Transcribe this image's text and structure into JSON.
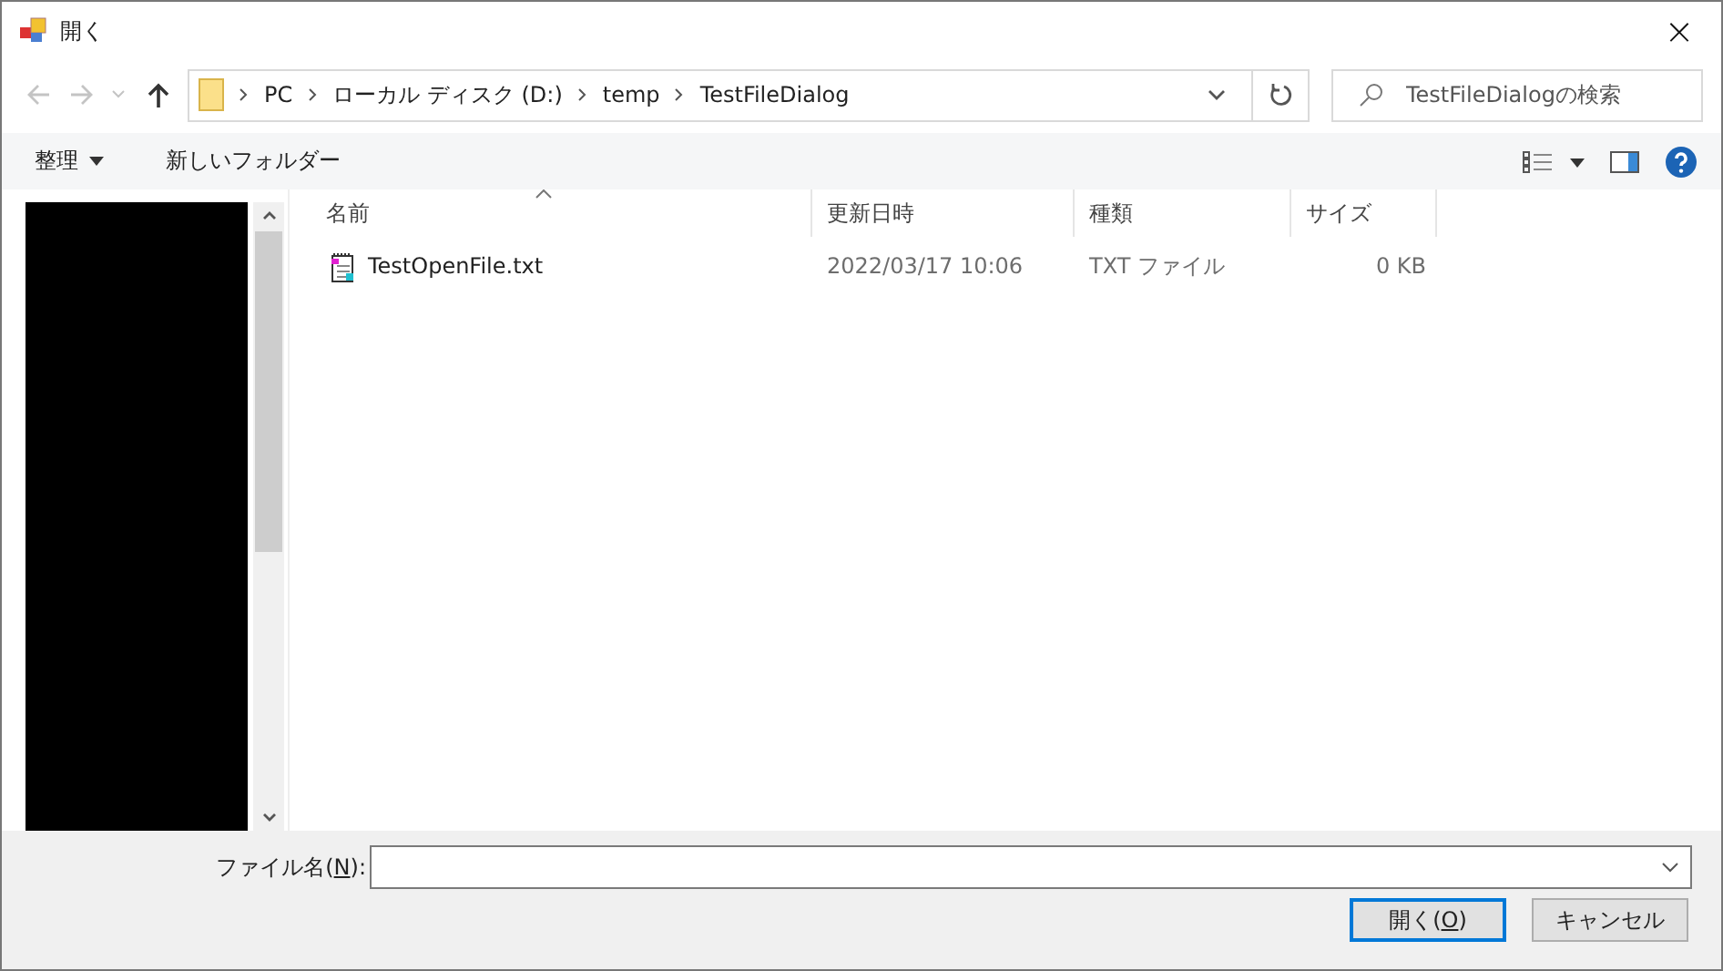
{
  "window": {
    "title": "開く",
    "close": "×"
  },
  "nav": {
    "back_disabled": true,
    "forward_disabled": true,
    "breadcrumbs": [
      "PC",
      "ローカル ディスク (D:)",
      "temp",
      "TestFileDialog"
    ],
    "search": {
      "placeholder": "TestFileDialogの検索"
    }
  },
  "toolbar": {
    "organize": "整理",
    "new_folder": "新しいフォルダー"
  },
  "sidebar": {
    "redacted": true
  },
  "table": {
    "columns": [
      {
        "label": "名前",
        "sorted": true
      },
      {
        "label": "更新日時",
        "sorted": false
      },
      {
        "label": "種類",
        "sorted": false
      },
      {
        "label": "サイズ",
        "sorted": false
      }
    ],
    "rows": [
      {
        "name": "TestOpenFile.txt",
        "modified": "2022/03/17 10:06",
        "type": "TXT ファイル",
        "size": "0 KB",
        "selected": false
      }
    ]
  },
  "filename": {
    "label_before": "ファイル名(",
    "access_key": "N",
    "label_after": "):"
  },
  "buttons": [
    {
      "kind": "default",
      "before": "開く(",
      "access_key": "O",
      "after": ")"
    },
    {
      "kind": "normal",
      "before": "キャンセル"
    }
  ]
}
